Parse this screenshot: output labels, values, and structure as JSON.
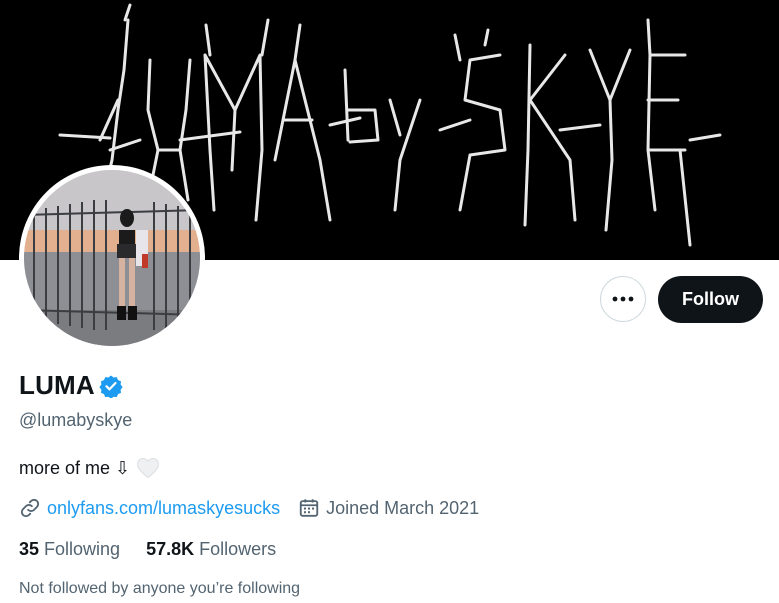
{
  "profile": {
    "banner_text": "LUMA by SKYE",
    "name": "LUMA",
    "handle": "@lumabyskye",
    "bio_text": "more of me ⇩",
    "link_text": "onlyfans.com/lumaskyesucks",
    "joined_text": "Joined March 2021",
    "following_count": "35",
    "following_label": "Following",
    "followers_count": "57.8K",
    "followers_label": "Followers",
    "not_followed_text": "Not followed by anyone you’re following"
  },
  "actions": {
    "follow_label": "Follow",
    "more_label": "•••"
  },
  "colors": {
    "accent": "#1d9bf0",
    "text": "#0f1419",
    "muted": "#536471",
    "follow_bg": "#0f1419"
  },
  "icons": {
    "more": "ellipsis-icon",
    "verified": "verified-badge-icon",
    "link": "link-icon",
    "calendar": "calendar-icon",
    "heart": "white-heart-icon"
  }
}
